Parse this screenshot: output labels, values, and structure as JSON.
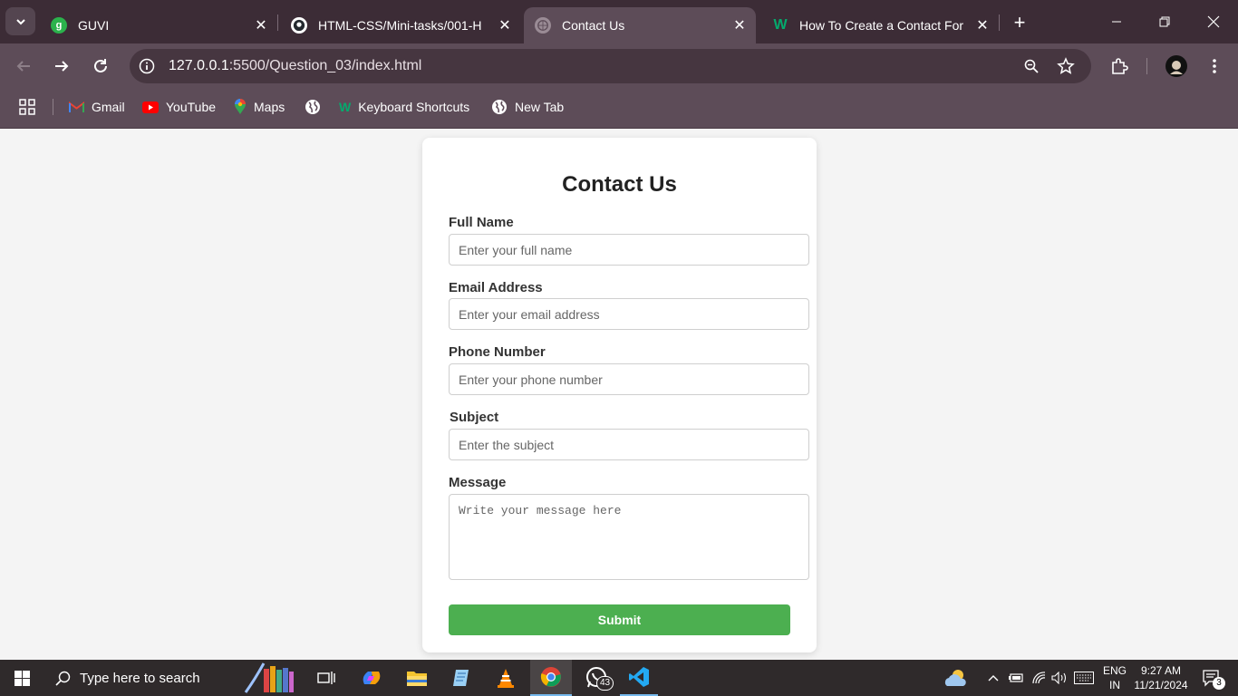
{
  "tabs": [
    {
      "title": "GUVI",
      "icon": "guvi-icon"
    },
    {
      "title": "HTML-CSS/Mini-tasks/001-H",
      "icon": "github-icon"
    },
    {
      "title": "Contact Us",
      "icon": "globe-icon",
      "active": true
    },
    {
      "title": "How To Create a Contact For",
      "icon": "w3-icon"
    }
  ],
  "address": {
    "host": "127.0.0.1",
    "path": ":5500/Question_03/index.html"
  },
  "bookmarks": [
    "Gmail",
    "YouTube",
    "Maps",
    "Keyboard Shortcuts",
    "New Tab"
  ],
  "form": {
    "title": "Contact Us",
    "fields": [
      {
        "label": "Full Name",
        "placeholder": "Enter your full name"
      },
      {
        "label": "Email Address",
        "placeholder": "Enter your email address"
      },
      {
        "label": "Phone Number",
        "placeholder": "Enter your phone number"
      },
      {
        "label": "Subject",
        "placeholder": "Enter the subject"
      },
      {
        "label": "Message",
        "placeholder": "Write your message here"
      }
    ],
    "submit": "Submit"
  },
  "taskbar": {
    "search_placeholder": "Type here to search",
    "whatsapp_badge": "43",
    "lang": "ENG",
    "region": "IN",
    "time": "9:27 AM",
    "date": "11/21/2024",
    "notifications": "3"
  },
  "colors": {
    "accent": "#4caf50",
    "chrome_frame": "#3c2c36",
    "chrome_toolbar": "#5d4c58"
  }
}
